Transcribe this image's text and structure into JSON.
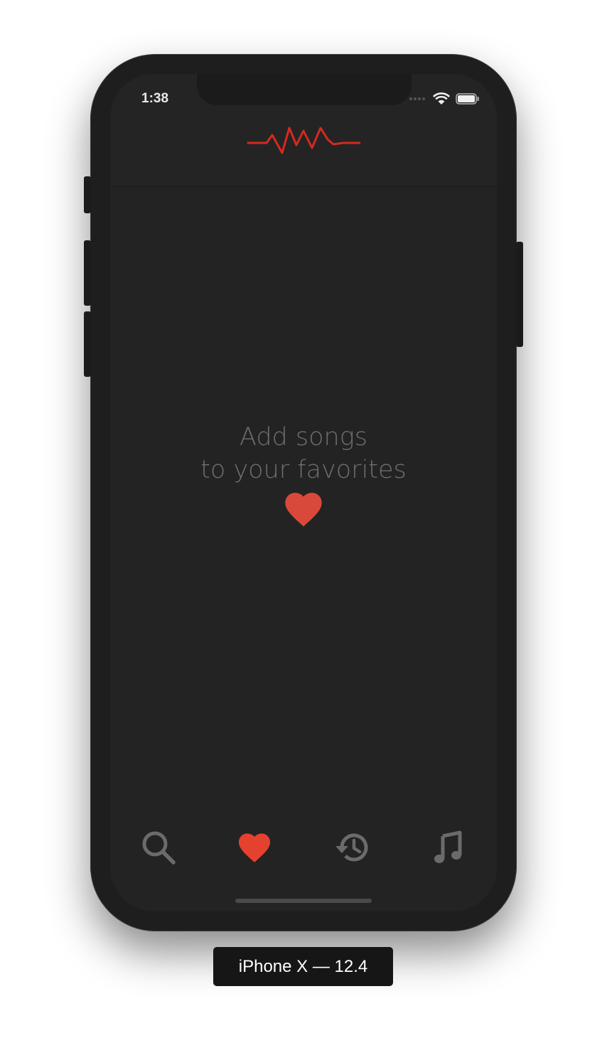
{
  "status_bar": {
    "time": "1:38",
    "icons": [
      "signal-dots-icon",
      "wifi-icon",
      "battery-icon"
    ]
  },
  "header": {
    "logo": "waveform-logo",
    "accent_color": "#d42a1f"
  },
  "empty_state": {
    "line1": "Add songs",
    "line2": "to your favorites",
    "icon": "heart-icon",
    "heart_color": "#d9493a"
  },
  "tab_bar": {
    "tabs": [
      {
        "name": "search",
        "icon": "search-icon",
        "active": false
      },
      {
        "name": "favorites",
        "icon": "heart-icon",
        "active": true
      },
      {
        "name": "history",
        "icon": "history-icon",
        "active": false
      },
      {
        "name": "music",
        "icon": "music-note-icon",
        "active": false
      }
    ],
    "active_color": "#e5412f",
    "inactive_color": "#6b6b6b"
  },
  "device_label": "iPhone X — 12.4"
}
